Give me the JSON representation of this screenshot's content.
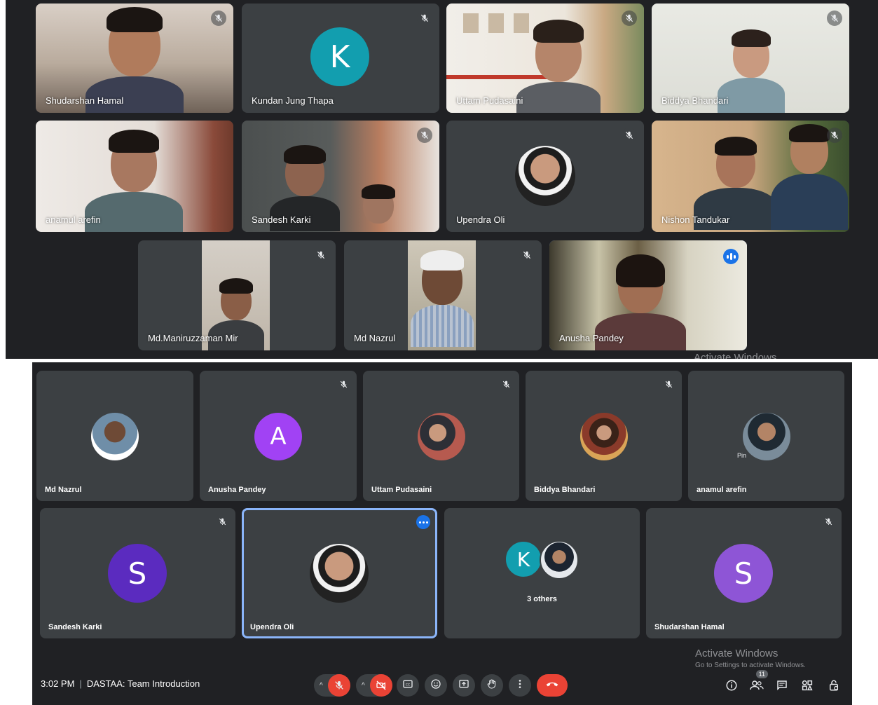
{
  "top_grid": {
    "participants": [
      {
        "name": "Shudarshan Hamal"
      },
      {
        "name": "Kundan Jung Thapa",
        "initial": "K"
      },
      {
        "name": "Uttam Pudasaini"
      },
      {
        "name": "Biddya Bhandari"
      },
      {
        "name": "anamul arefin"
      },
      {
        "name": "Sandesh Karki"
      },
      {
        "name": "Upendra Oli"
      },
      {
        "name": "Nishon Tandukar"
      },
      {
        "name": "Md.Maniruzzaman Mir"
      },
      {
        "name": "Md Nazrul"
      },
      {
        "name": "Anusha Pandey"
      }
    ],
    "watermark": "Activate Windows"
  },
  "bottom_grid": {
    "participants": [
      {
        "name": "Md Nazrul"
      },
      {
        "name": "Anusha Pandey",
        "initial": "A"
      },
      {
        "name": "Uttam Pudasaini"
      },
      {
        "name": "Biddya Bhandari"
      },
      {
        "name": "anamul arefin",
        "hover": "Pin"
      },
      {
        "name": "Sandesh Karki",
        "initial": "S"
      },
      {
        "name": "Upendra Oli"
      },
      {
        "name": "3 others",
        "initial": "K"
      },
      {
        "name": "Shudarshan Hamal",
        "initial": "S"
      }
    ],
    "meeting": {
      "time": "3:02 PM",
      "separator": "|",
      "title": "DASTAA: Team Introduction"
    },
    "people_count": "11",
    "watermark": {
      "title": "Activate Windows",
      "subtitle": "Go to Settings to activate Windows."
    }
  },
  "colors": {
    "bg": "#202124",
    "tile": "#3c4043",
    "accent": "#8ab4f8",
    "red": "#ea4335",
    "teal": "#129eaf",
    "purple_a": "#a142f4",
    "purple_s1": "#5b2bbf",
    "purple_s2": "#8e55d6"
  },
  "icons": [
    "mic-off-icon",
    "camera-off-icon",
    "captions-icon",
    "emoji-icon",
    "present-icon",
    "raise-hand-icon",
    "more-icon",
    "end-call-icon",
    "info-icon",
    "people-icon",
    "chat-icon",
    "activities-icon",
    "host-controls-icon"
  ]
}
